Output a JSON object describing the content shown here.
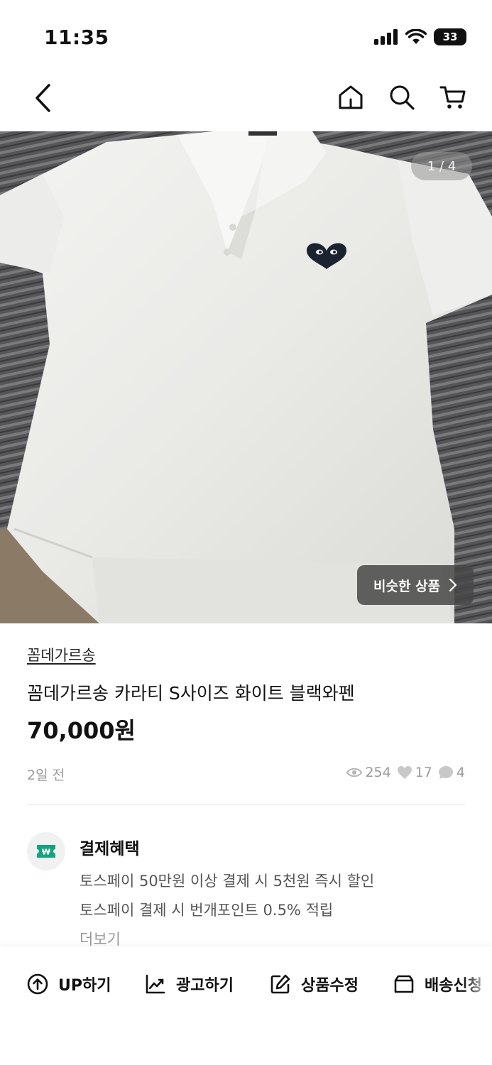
{
  "status_bar": {
    "time": "11:35",
    "battery": "33"
  },
  "gallery": {
    "counter": "1 / 4",
    "similar_label": "비슷한 상품"
  },
  "product": {
    "brand": "꼼데가르송",
    "title": "꼼데가르송 카라티 S사이즈 화이트 블랙와펜",
    "price": "70,000원",
    "posted": "2일 전",
    "views": "254",
    "likes": "17",
    "chats": "4"
  },
  "benefit": {
    "title": "결제혜택",
    "line1": "토스페이 50만원 이상 결제 시 5천원 즉시 할인",
    "line2": "토스페이 결제 시 번개포인트 0.5% 적립",
    "more": "더보기",
    "accent_color": "#14a37f"
  },
  "actions": [
    {
      "label": "UP하기",
      "icon": "arrow-up-circle-icon"
    },
    {
      "label": "광고하기",
      "icon": "trend-chart-icon"
    },
    {
      "label": "상품수정",
      "icon": "edit-icon"
    },
    {
      "label": "배송신청",
      "icon": "box-icon"
    }
  ]
}
